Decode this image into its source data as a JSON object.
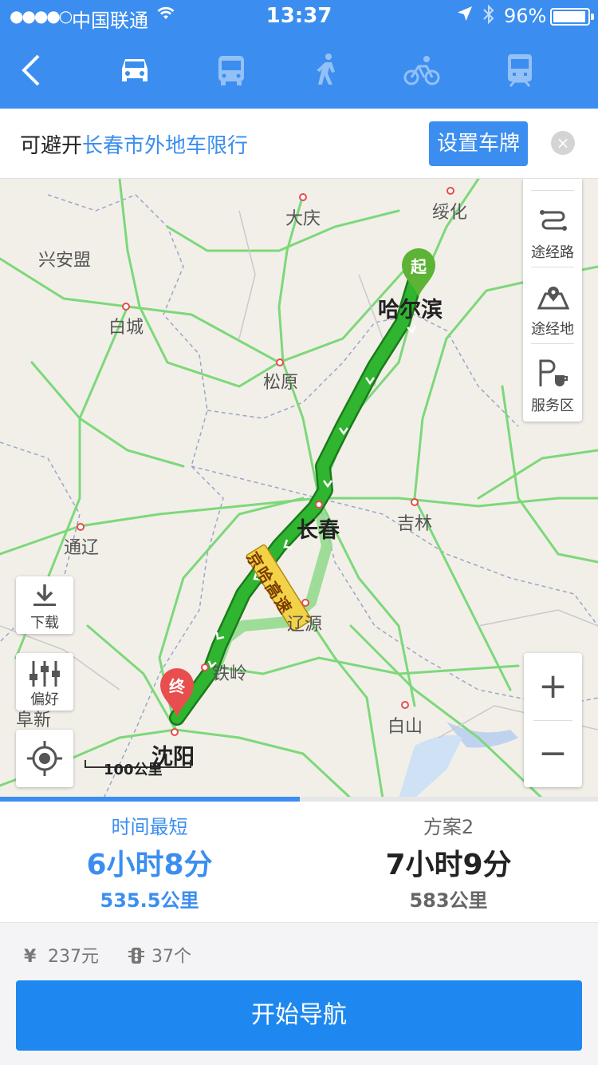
{
  "status_bar": {
    "signal": "●●●●○",
    "carrier": "中国联通",
    "time": "13:37",
    "battery": "96%"
  },
  "nav": {
    "modes": [
      "car",
      "bus",
      "walk",
      "bike",
      "train"
    ],
    "active_mode": "car"
  },
  "restriction": {
    "prefix": "可避开",
    "link": "长春市外地车限行",
    "button": "设置车牌",
    "close": "×"
  },
  "map": {
    "cities": {
      "daqing": "大庆",
      "suihua": "绥化",
      "xinganmeng": "兴安盟",
      "baicheng": "白城",
      "haerbin": "哈尔滨",
      "songyuan": "松原",
      "changchun": "长春",
      "jilin": "吉林",
      "tongliao": "通辽",
      "liaoyuan": "辽源",
      "tieling": "铁岭",
      "baishan": "白山",
      "fuxin": "阜新",
      "shenyang": "沈阳"
    },
    "highway_label": "京哈高速",
    "start_pin": "起",
    "end_pin": "终",
    "scale": "100公里",
    "side_panel": {
      "waypoint_route": "途经路",
      "waypoint_place": "途经地",
      "service_area": "服务区"
    },
    "tools": {
      "download": "下载",
      "preference": "偏好"
    },
    "zoom_in": "+",
    "zoom_out": "−"
  },
  "routes": [
    {
      "name": "时间最短",
      "duration": "6小时8分",
      "distance": "535.5公里",
      "selected": true
    },
    {
      "name": "方案2",
      "duration": "7小时9分",
      "distance": "583公里",
      "selected": false
    }
  ],
  "info": {
    "cost": "237元",
    "traffic_lights": "37个"
  },
  "start_button": "开始导航",
  "colors": {
    "accent": "#3b8ef0",
    "route_main": "#2fb52f",
    "route_alt": "#9ee09a",
    "start_pin": "#5cb335",
    "end_pin": "#e84e4e"
  }
}
